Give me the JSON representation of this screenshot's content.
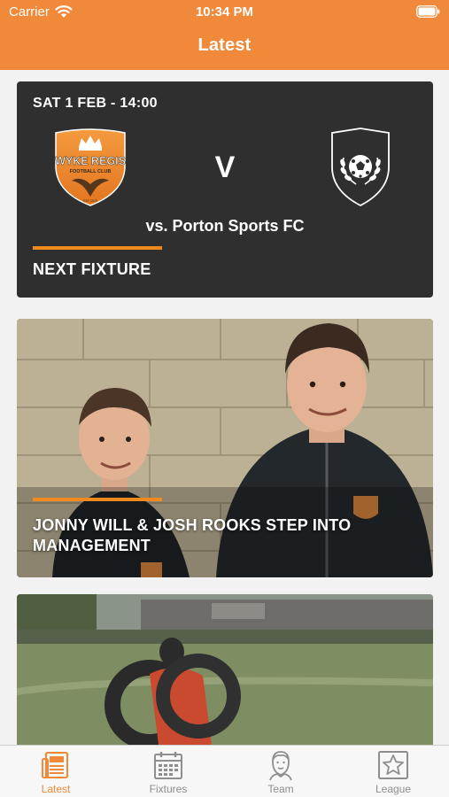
{
  "status_bar": {
    "carrier": "Carrier",
    "time": "10:34 PM"
  },
  "header": {
    "title": "Latest"
  },
  "fixture_card": {
    "date": "SAT 1 FEB - 14:00",
    "home_crest_text": "WYKE REGIS",
    "home_crest_subtext": "FOOTBALL CLUB",
    "home_crest_est": "EST 1975",
    "versus": "V",
    "opponent": "vs. Porton Sports FC",
    "label": "NEXT FIXTURE"
  },
  "news": [
    {
      "title": "JONNY WILL & JOSH ROOKS STEP INTO MANAGEMENT"
    }
  ],
  "tabs": [
    {
      "label": "Latest",
      "icon": "newspaper-icon",
      "active": true
    },
    {
      "label": "Fixtures",
      "icon": "calendar-icon",
      "active": false
    },
    {
      "label": "Team",
      "icon": "player-icon",
      "active": false
    },
    {
      "label": "League",
      "icon": "star-badge-icon",
      "active": false
    }
  ],
  "colors": {
    "brand": "#f08a3a",
    "card_dark": "#2f2f2f",
    "accent": "#f08a1c",
    "tab_inactive": "#8e8e8e"
  }
}
